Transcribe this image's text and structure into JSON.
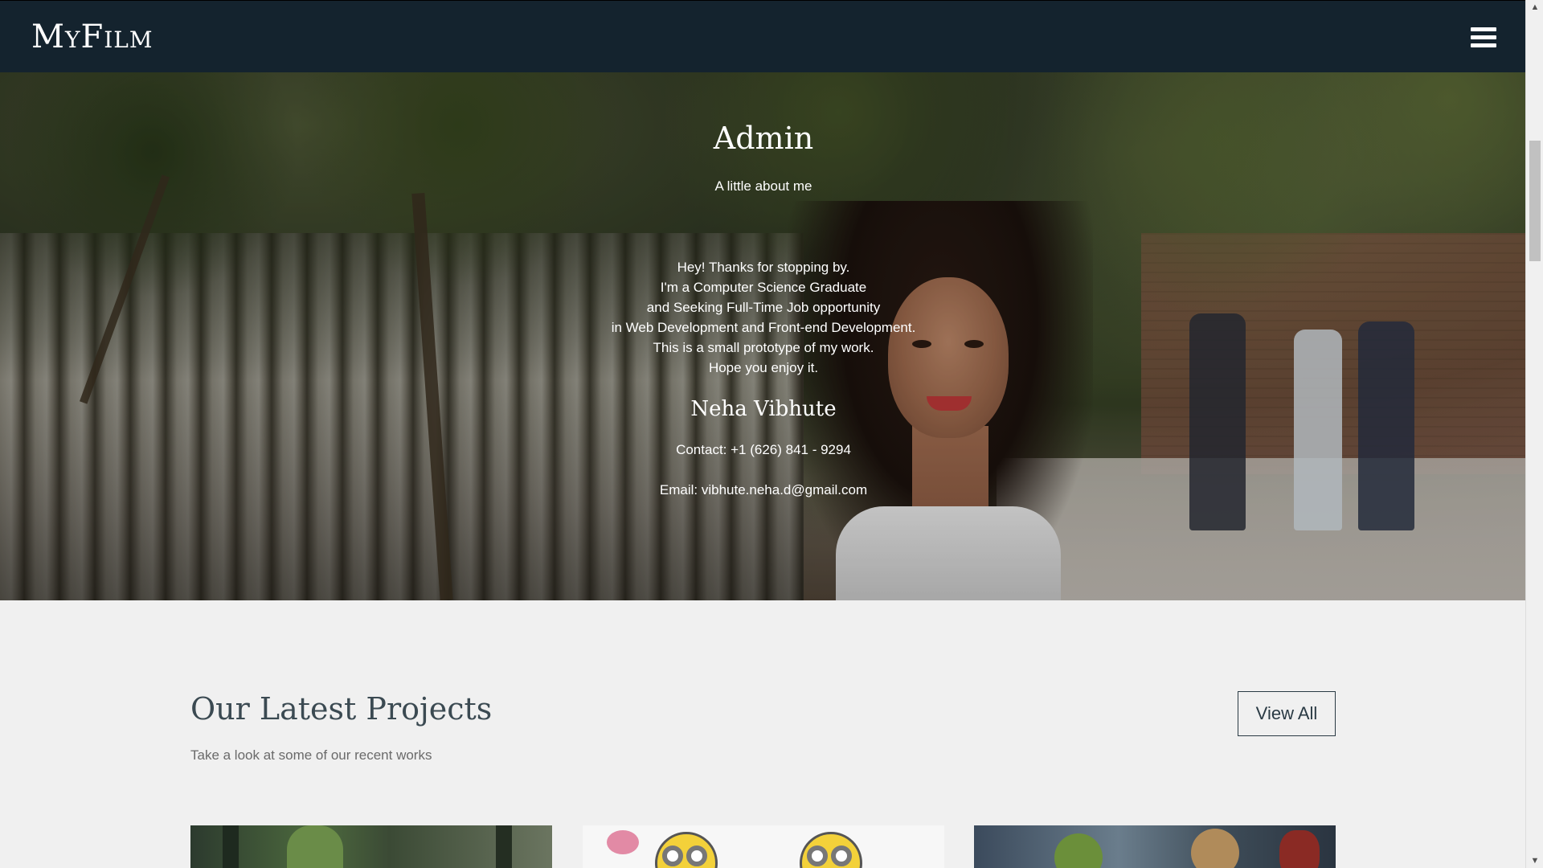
{
  "navbar": {
    "brand": "MyFilm",
    "menu_icon": "hamburger-menu-icon"
  },
  "hero": {
    "title": "Admin",
    "subtitle": "A little about me",
    "bio": "Hey! Thanks for stopping by.\nI'm a Computer Science Graduate\nand Seeking Full-Time Job opportunity\nin Web Development and Front-end Development.\nThis is a small prototype of my work.\nHope you enjoy it.",
    "name": "Neha Vibhute",
    "contact": "Contact: +1 (626) 841 - 9294",
    "email": "Email: vibhute.neha.d@gmail.com"
  },
  "projects": {
    "title": "Our Latest Projects",
    "subtitle": "Take a look at some of our recent works",
    "view_all_label": "View All"
  },
  "scrollbar": {
    "up_icon": "scroll-up-arrow-icon",
    "down_icon": "scroll-down-arrow-icon"
  },
  "colors": {
    "navbar_bg": "#14232e",
    "page_bg": "#f0f0f0",
    "heading_text": "#3b4a52"
  }
}
